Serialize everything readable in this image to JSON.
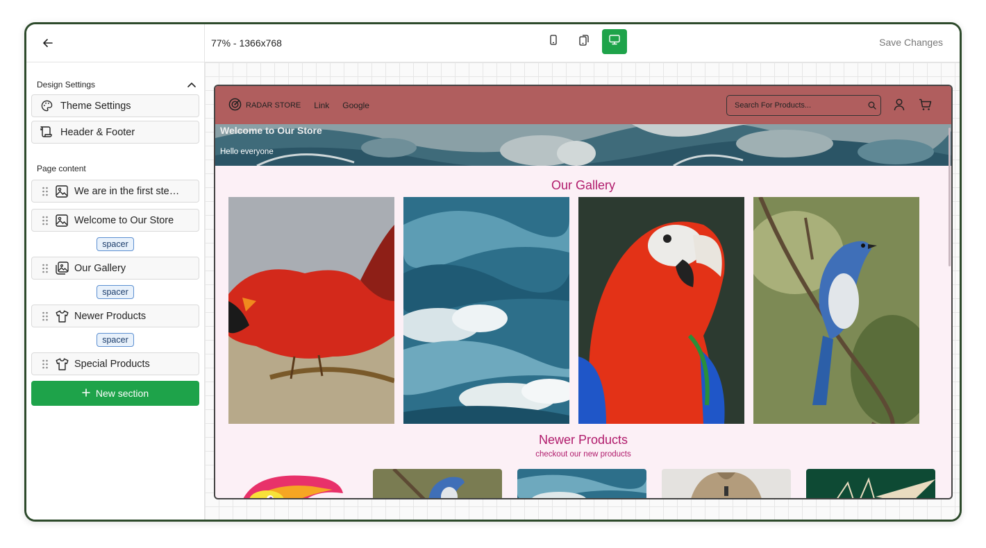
{
  "sidebar": {
    "design_settings_title": "Design Settings",
    "design_items": [
      {
        "label": "Theme Settings",
        "icon": "palette-icon"
      },
      {
        "label": "Header & Footer",
        "icon": "scroll-icon"
      }
    ],
    "page_content_title": "Page content",
    "sections": [
      {
        "label": "We are in the first ste…",
        "icon": "image-icon"
      },
      {
        "label": "Welcome to Our Store",
        "icon": "image-icon"
      },
      {
        "label": "Our Gallery",
        "icon": "images-icon"
      },
      {
        "label": "Newer Products",
        "icon": "shirt-icon"
      },
      {
        "label": "Special Products",
        "icon": "shirt-icon"
      }
    ],
    "spacer_label": "spacer",
    "new_section_label": "New section"
  },
  "topbar": {
    "zoom_label": "77% - 1366x768",
    "devices": [
      "mobile",
      "tablet",
      "desktop"
    ],
    "active_device": "desktop",
    "save_label": "Save Changes"
  },
  "preview": {
    "brand": "RADAR STORE",
    "nav_links": [
      "Link",
      "Google"
    ],
    "search_placeholder": "Search For Products...",
    "hero_title": "Welcome to Our Store",
    "hero_subtitle": "Hello everyone",
    "gallery_title": "Our Gallery",
    "gallery_images": [
      "cardinal-bird",
      "blue-waves",
      "scarlet-macaw",
      "blue-jay"
    ],
    "newer_title": "Newer Products",
    "newer_subtitle": "checkout our new products",
    "product_images": [
      "colorful-bird-logo",
      "blue-jay",
      "blue-waves",
      "beige-jacket",
      "paper-plane"
    ]
  },
  "colors": {
    "accent_green": "#1ea34a",
    "store_header": "#b05e5e",
    "heading_magenta": "#b01a6b",
    "page_bg": "#fcf0f6",
    "frame_border": "#2d4a2b"
  }
}
